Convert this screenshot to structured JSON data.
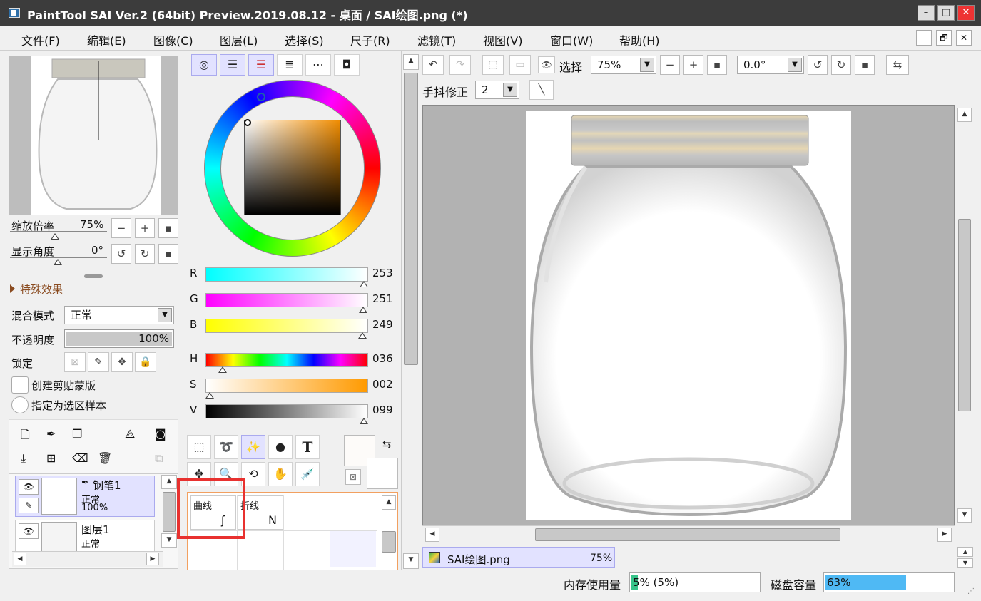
{
  "window": {
    "title": "PaintTool SAI Ver.2 (64bit) Preview.2019.08.12 - 桌面 / SAI绘图.png (*)"
  },
  "menu": [
    "文件(F)",
    "编辑(E)",
    "图像(C)",
    "图层(L)",
    "选择(S)",
    "尺子(R)",
    "滤镜(T)",
    "视图(V)",
    "窗口(W)",
    "帮助(H)"
  ],
  "navigator": {
    "zoom_label": "缩放倍率",
    "zoom_value": "75%",
    "angle_label": "显示角度",
    "angle_value": "0°"
  },
  "layer_props": {
    "effects_label": "特殊效果",
    "blend_label": "混合模式",
    "blend_value": "正常",
    "opacity_label": "不透明度",
    "opacity_value": "100%",
    "lock_label": "锁定",
    "clip_label": "创建剪贴蒙版",
    "sample_label": "指定为选区样本"
  },
  "layers": [
    {
      "name": "钢笔1",
      "mode": "正常",
      "opacity": "100%"
    },
    {
      "name": "图层1",
      "mode": "正常"
    }
  ],
  "color": {
    "r": {
      "label": "R",
      "value": "253"
    },
    "g": {
      "label": "G",
      "value": "251"
    },
    "b": {
      "label": "B",
      "value": "249"
    },
    "h": {
      "label": "H",
      "value": "036"
    },
    "s": {
      "label": "S",
      "value": "002"
    },
    "v": {
      "label": "V",
      "value": "099"
    }
  },
  "pen_tools": {
    "curve": "曲线",
    "polyline": "折线"
  },
  "toolbar": {
    "select_label": "选择",
    "zoom": "75%",
    "angle": "0.0°",
    "stabilizer_label": "手抖修正",
    "stabilizer_value": "2"
  },
  "doc_tab": {
    "name": "SAI绘图.png",
    "zoom": "75%"
  },
  "status": {
    "mem_label": "内存使用量",
    "mem_value": "5% (5%)",
    "mem_fraction": 0.05,
    "disk_label": "磁盘容量",
    "disk_value": "63%",
    "disk_fraction": 0.63
  },
  "colors": {
    "accent_select": "#e2e2ff",
    "highlight_box": "#e8312f",
    "disk_bar": "#4fb9f4",
    "mem_bar": "#36c48a"
  }
}
